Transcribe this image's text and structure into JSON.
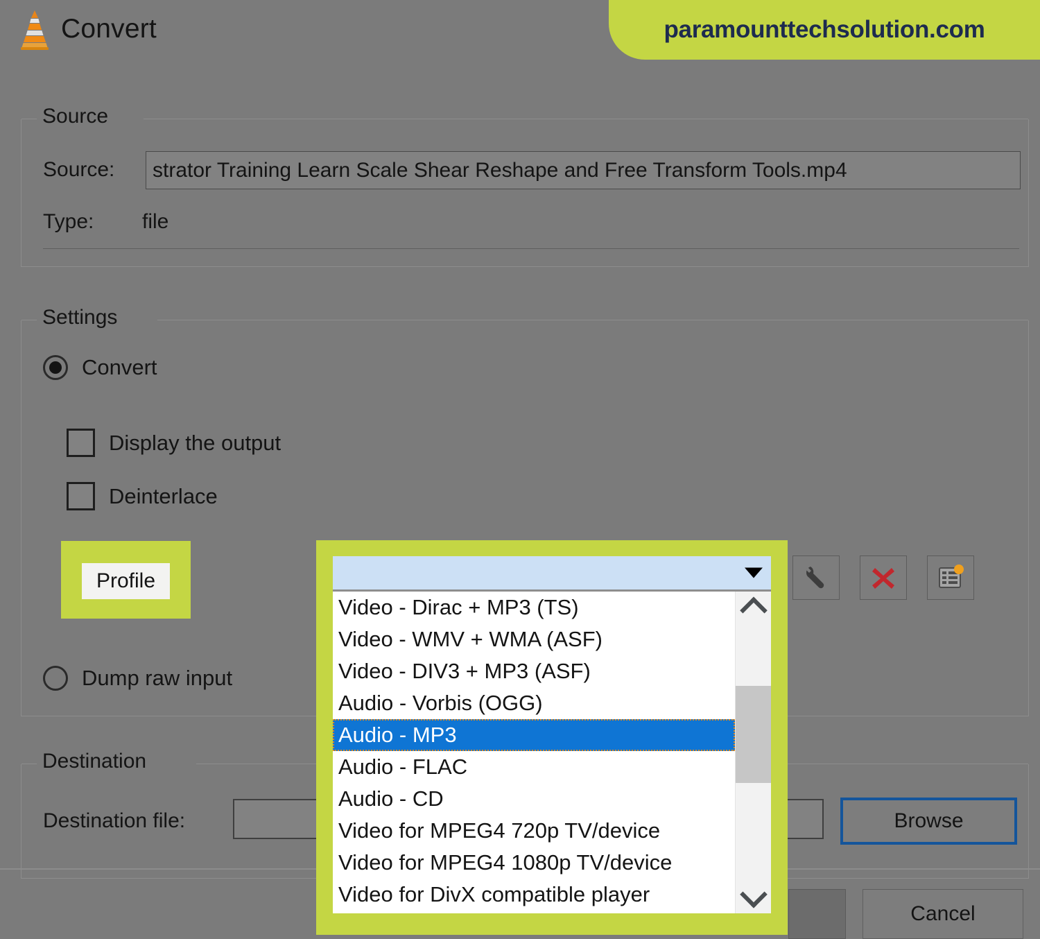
{
  "window": {
    "title": "Convert",
    "icon": "vlc-cone-icon"
  },
  "watermark": {
    "text": "paramounttechsolution.com",
    "bg_color": "#c4d644",
    "text_color": "#1d2b4f"
  },
  "source_group": {
    "title": "Source",
    "source_label": "Source:",
    "source_value": "strator Training  Learn Scale Shear Reshape and Free Transform Tools.mp4",
    "type_label": "Type:",
    "type_value": "file"
  },
  "settings_group": {
    "title": "Settings",
    "convert_radio_label": "Convert",
    "display_output_label": "Display the output",
    "deinterlace_label": "Deinterlace",
    "profile_label": "Profile",
    "dump_raw_input_label": "Dump raw input",
    "icon_buttons": [
      {
        "name": "wrench-icon",
        "title": "Edit selected profile"
      },
      {
        "name": "close-icon",
        "title": "Delete selected profile"
      },
      {
        "name": "new-profile-icon",
        "title": "Create a new profile"
      }
    ]
  },
  "destination_group": {
    "title": "Destination",
    "dest_file_label": "Destination file:",
    "dest_file_value": "",
    "browse_label": "Browse"
  },
  "footer": {
    "start_label": "",
    "cancel_label": "Cancel"
  },
  "profile_dropdown": {
    "selected_value": "",
    "highlight_color": "#c4d644",
    "selection_color": "#0f75d4",
    "combo_bg_color": "#cce0f5",
    "options": [
      "Video - Dirac + MP3 (TS)",
      "Video - WMV + WMA (ASF)",
      "Video - DIV3 + MP3 (ASF)",
      "Audio - Vorbis (OGG)",
      "Audio - MP3",
      "Audio - FLAC",
      "Audio - CD",
      "Video for MPEG4 720p TV/device",
      "Video for MPEG4 1080p TV/device",
      "Video for DivX compatible player"
    ],
    "selected_index": 4,
    "scroll_up_icon": "chevron-up-icon",
    "scroll_down_icon": "chevron-down-icon"
  },
  "colors": {
    "window_bg": "#7b7b7b",
    "accent_focus": "#14559b"
  }
}
